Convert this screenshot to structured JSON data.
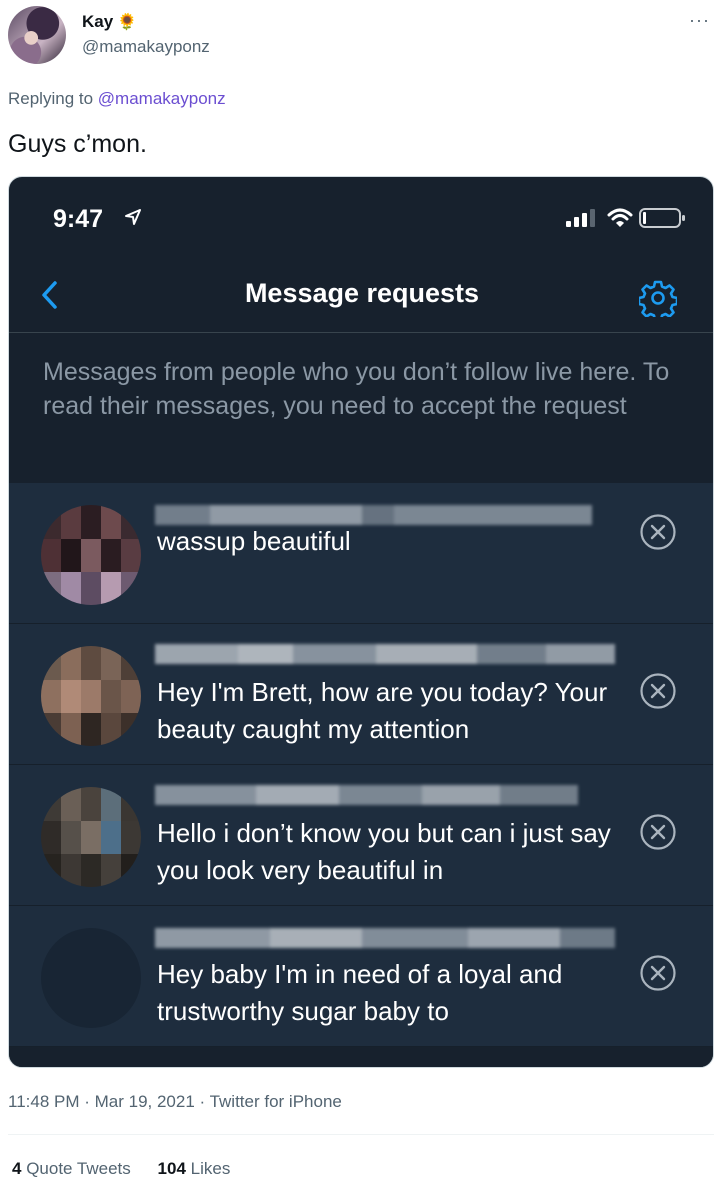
{
  "tweet": {
    "author_name": "Kay",
    "author_emoji": "🌻",
    "author_handle": "@mamakayponz",
    "more_icon": "more-horizontal-icon",
    "replying_prefix": "Replying to",
    "replying_handle": "@mamakayponz",
    "text": "Guys c’mon.",
    "timestamp": "11:48 PM · Mar 19, 2021 · Twitter for iPhone",
    "stats": [
      {
        "count": "4",
        "label": "Quote Tweets"
      },
      {
        "count": "104",
        "label": "Likes"
      }
    ]
  },
  "screenshot": {
    "status_bar": {
      "time": "9:47",
      "icons": [
        "location-arrow-icon",
        "cellular-signal-icon",
        "wifi-icon",
        "battery-icon"
      ]
    },
    "nav": {
      "back_icon": "chevron-left-icon",
      "title": "Message requests",
      "settings_icon": "gear-icon"
    },
    "info_text": "Messages from people who you don’t follow live here. To read their messages, you need to accept the request",
    "requests": [
      {
        "sender": "[pixelated]",
        "message": "wassup beautiful",
        "dismiss_icon": "close-circle-icon"
      },
      {
        "sender": "[pixelated]",
        "message": "Hey I'm Brett, how are you today? Your beauty caught my attention",
        "dismiss_icon": "close-circle-icon"
      },
      {
        "sender": "[pixelated]",
        "message": "Hello i don’t know you but can i just say you look very beautiful in",
        "dismiss_icon": "close-circle-icon"
      },
      {
        "sender": "[pixelated]",
        "message": "Hey baby I'm in need of a loyal and trustworthy sugar baby to",
        "dismiss_icon": "close-circle-icon"
      }
    ],
    "colors": {
      "background": "#17212d",
      "row_background": "#1e2d3e",
      "accent": "#1d9bf0",
      "muted_text": "#8b98a5"
    }
  }
}
